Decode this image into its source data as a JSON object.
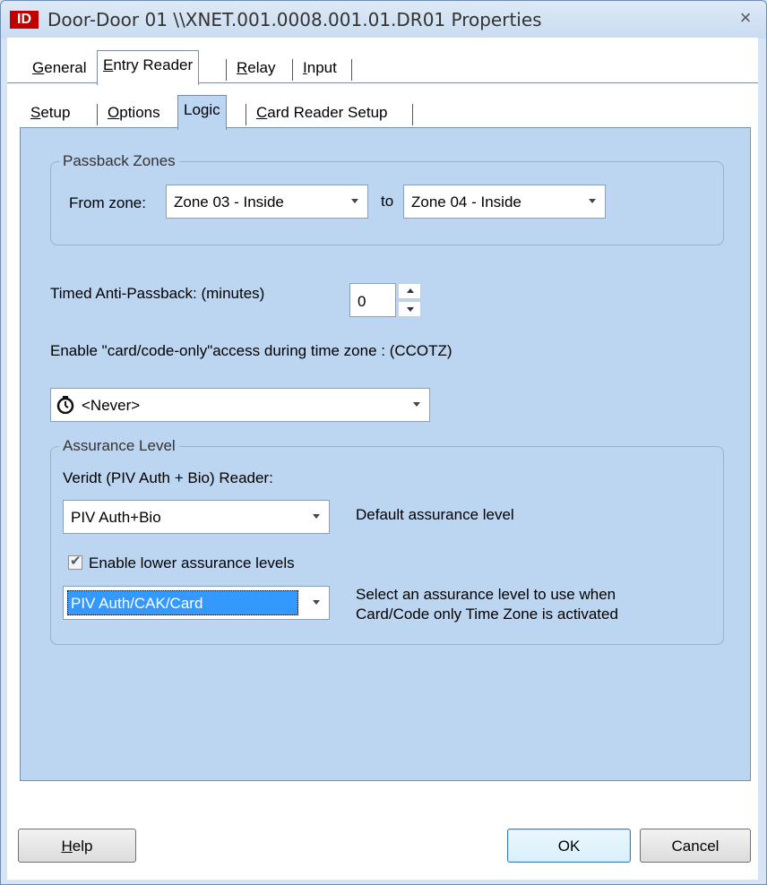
{
  "window": {
    "app_icon_text": "ID",
    "title": "Door-Door 01 \\\\XNET.001.0008.001.01.DR01 Properties",
    "close_glyph": "×"
  },
  "top_tabs": [
    {
      "key": "G",
      "rest": "eneral",
      "selected": false
    },
    {
      "key": "E",
      "rest": "ntry Reader",
      "selected": true
    },
    {
      "key": "R",
      "rest": "elay",
      "selected": false
    },
    {
      "key": "I",
      "rest": "nput",
      "selected": false
    }
  ],
  "sub_tabs": [
    {
      "key": "S",
      "rest": "etup",
      "selected": false
    },
    {
      "key": "O",
      "rest": "ptions",
      "selected": false
    },
    {
      "key": "",
      "rest": "Logic",
      "selected": true
    },
    {
      "key": "C",
      "rest": "ard Reader Setup",
      "selected": false
    }
  ],
  "passback": {
    "group_label": "Passback Zones",
    "from_label": "From zone:",
    "from_value": "Zone 03 - Inside",
    "to_label": "to",
    "to_value": "Zone 04 - Inside"
  },
  "timed_antipassback": {
    "label": "Timed Anti-Passback: (minutes)",
    "value": "0"
  },
  "ccotz": {
    "label": "Enable \"card/code-only\"access during time zone : (CCOTZ)",
    "value": "<Never>",
    "icon": "clock-icon"
  },
  "assurance": {
    "group_label": "Assurance Level",
    "reader_label": "Veridt (PIV Auth + Bio) Reader:",
    "default_value": "PIV Auth+Bio",
    "default_desc": "Default assurance level",
    "enable_lower_label": "Enable lower assurance levels",
    "enable_lower_checked": true,
    "lower_value": "PIV Auth/CAK/Card",
    "lower_desc_line1": "Select an assurance level to use when",
    "lower_desc_line2": "Card/Code only Time Zone is activated"
  },
  "buttons": {
    "help_key": "H",
    "help_rest": "elp",
    "ok": "OK",
    "cancel": "Cancel"
  },
  "colors": {
    "panel_bg": "#bcd5f1",
    "selection": "#3399ff",
    "title_icon": "#c00000"
  }
}
